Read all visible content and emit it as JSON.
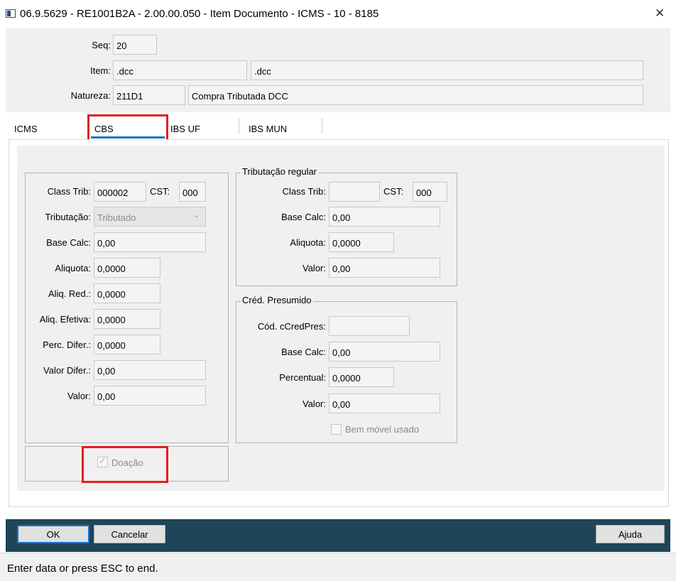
{
  "window": {
    "title": "06.9.5629 - RE1001B2A - 2.00.00.050 - Item Documento - ICMS - 10 - 8185",
    "close_glyph": "✕"
  },
  "header": {
    "seq": {
      "label": "Seq:",
      "value": "20"
    },
    "item": {
      "label": "Item:",
      "value1": ".dcc",
      "value2": ".dcc"
    },
    "natureza": {
      "label": "Natureza:",
      "code": "211D1",
      "description": "Compra Tributada DCC"
    }
  },
  "tabs": [
    {
      "label": "ICMS"
    },
    {
      "label": "CBS"
    },
    {
      "label": "IBS UF"
    },
    {
      "label": "IBS MUN"
    }
  ],
  "left": {
    "class_trib": {
      "label": "Class Trib:",
      "value": "000002"
    },
    "cst": {
      "label": "CST:",
      "value": "000"
    },
    "tributacao": {
      "label": "Tributação:",
      "value": "Tributado"
    },
    "base_calc": {
      "label": "Base Calc:",
      "value": "0,00"
    },
    "aliquota": {
      "label": "Aliquota:",
      "value": "0,0000"
    },
    "aliq_red": {
      "label": "Aliq. Red.:",
      "value": "0,0000"
    },
    "aliq_efetiva": {
      "label": "Aliq. Efetiva:",
      "value": "0,0000"
    },
    "perc_difer": {
      "label": "Perc. Difer.:",
      "value": "0,0000"
    },
    "valor_difer": {
      "label": "Valor Difer.:",
      "value": "0,00"
    },
    "valor": {
      "label": "Valor:",
      "value": "0,00"
    },
    "doacao": {
      "label": "Doação",
      "checked": true
    }
  },
  "tributacao_regular": {
    "legend": "Tributação regular",
    "class_trib": {
      "label": "Class Trib:",
      "value": ""
    },
    "cst": {
      "label": "CST:",
      "value": "000"
    },
    "base_calc": {
      "label": "Base Calc:",
      "value": "0,00"
    },
    "aliquota": {
      "label": "Aliquota:",
      "value": "0,0000"
    },
    "valor": {
      "label": "Valor:",
      "value": "0,00"
    }
  },
  "cred_presumido": {
    "legend": "Créd. Presumido",
    "cod": {
      "label": "Cód. cCredPres:",
      "value": ""
    },
    "base_calc": {
      "label": "Base Calc:",
      "value": "0,00"
    },
    "percentual": {
      "label": "Percentual:",
      "value": "0,0000"
    },
    "valor": {
      "label": "Valor:",
      "value": "0,00"
    },
    "bem_movel": {
      "label": "Bem móvel usado",
      "checked": false
    }
  },
  "buttons": {
    "ok": "OK",
    "cancelar": "Cancelar",
    "ajuda": "Ajuda"
  },
  "status": "Enter data or press ESC to end.",
  "colors": {
    "footer_bar": "#1e4558",
    "highlight": "#e31e24",
    "tab_active": "#1a73c9",
    "panel_bg": "#f0f0f0"
  }
}
